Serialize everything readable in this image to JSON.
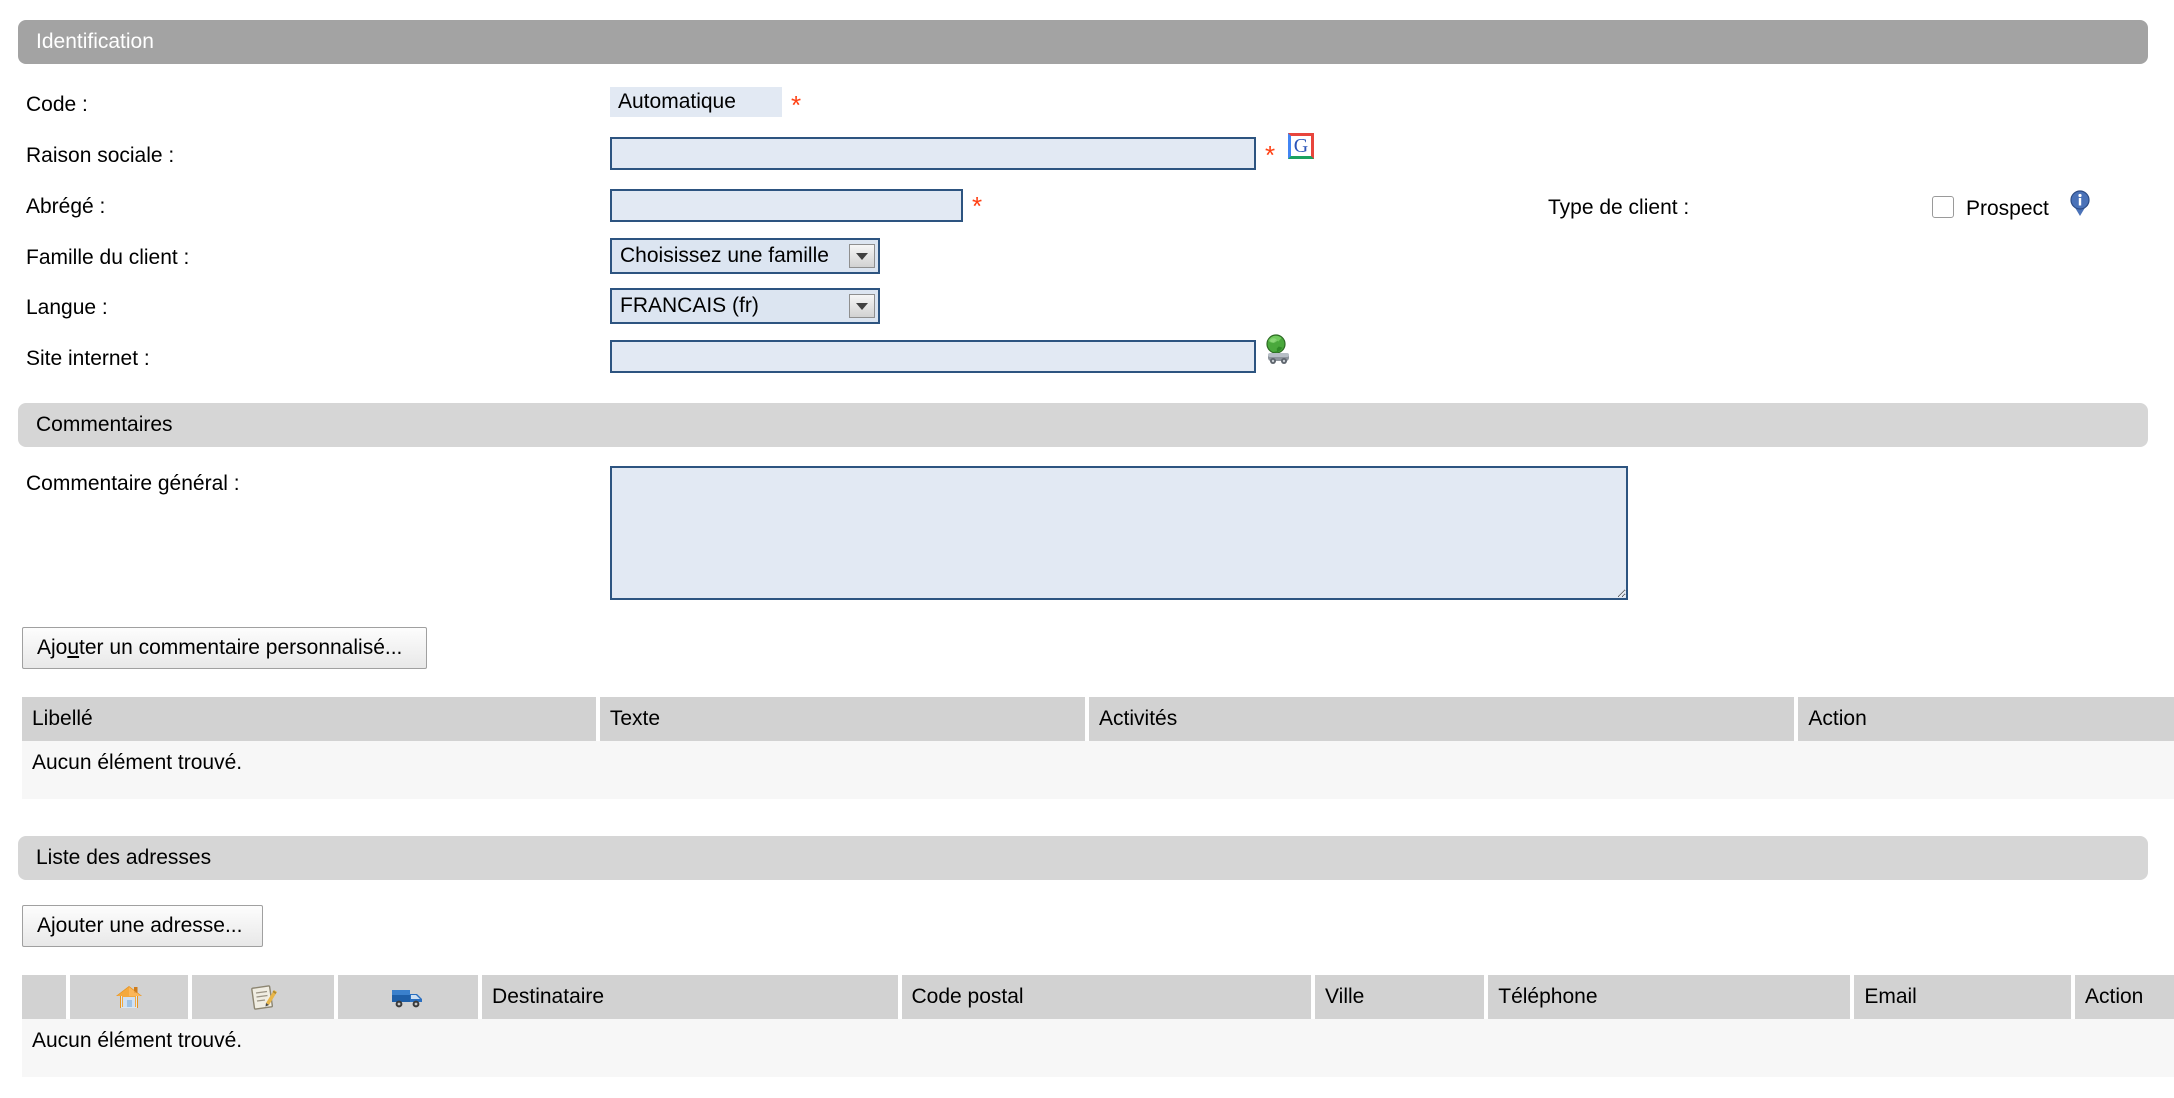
{
  "sections": {
    "identification": "Identification",
    "commentaires": "Commentaires",
    "liste_adresses": "Liste des adresses"
  },
  "identification": {
    "code_label": "Code :",
    "code_value": "Automatique",
    "code_required": "*",
    "raison_sociale_label": "Raison sociale :",
    "raison_sociale_value": "",
    "raison_sociale_required": "*",
    "google_icon": "google-g-icon",
    "abrege_label": "Abrégé :",
    "abrege_value": "",
    "abrege_required": "*",
    "famille_label": "Famille du client :",
    "famille_value": "Choisissez une famille",
    "langue_label": "Langue :",
    "langue_value": "FRANCAIS (fr)",
    "site_label": "Site internet :",
    "site_value": "",
    "site_icon": "world-globe-go-icon",
    "type_client_label": "Type de client :",
    "prospect_label": "Prospect",
    "prospect_checked": false,
    "info_icon": "info-bubble-icon"
  },
  "commentaires": {
    "commentaire_general_label": "Commentaire général :",
    "commentaire_general_value": "",
    "add_comment_button_pre": "Ajo",
    "add_comment_button_key": "u",
    "add_comment_button_post": "ter un commentaire personnalisé...",
    "table": {
      "columns": [
        "Libellé",
        "Texte",
        "Activités",
        "Action"
      ],
      "empty_message": "Aucun élément trouvé.",
      "rows": []
    }
  },
  "adresses": {
    "add_address_button": "Ajouter une adresse...",
    "table": {
      "icon_columns": [
        "home-icon",
        "invoice-clipboard-icon",
        "delivery-truck-icon"
      ],
      "columns": [
        "Destinataire",
        "Code postal",
        "Ville",
        "Téléphone",
        "Email",
        "Action"
      ],
      "empty_message": "Aucun élément trouvé.",
      "rows": []
    }
  },
  "colors": {
    "header_dark": "#a3a3a3",
    "header_light": "#d6d6d6",
    "field_bg": "#e2e9f3",
    "field_border": "#2d5480",
    "required_star": "#ff4013",
    "table_header": "#d2d2d2",
    "table_empty_row": "#f7f7f7"
  }
}
